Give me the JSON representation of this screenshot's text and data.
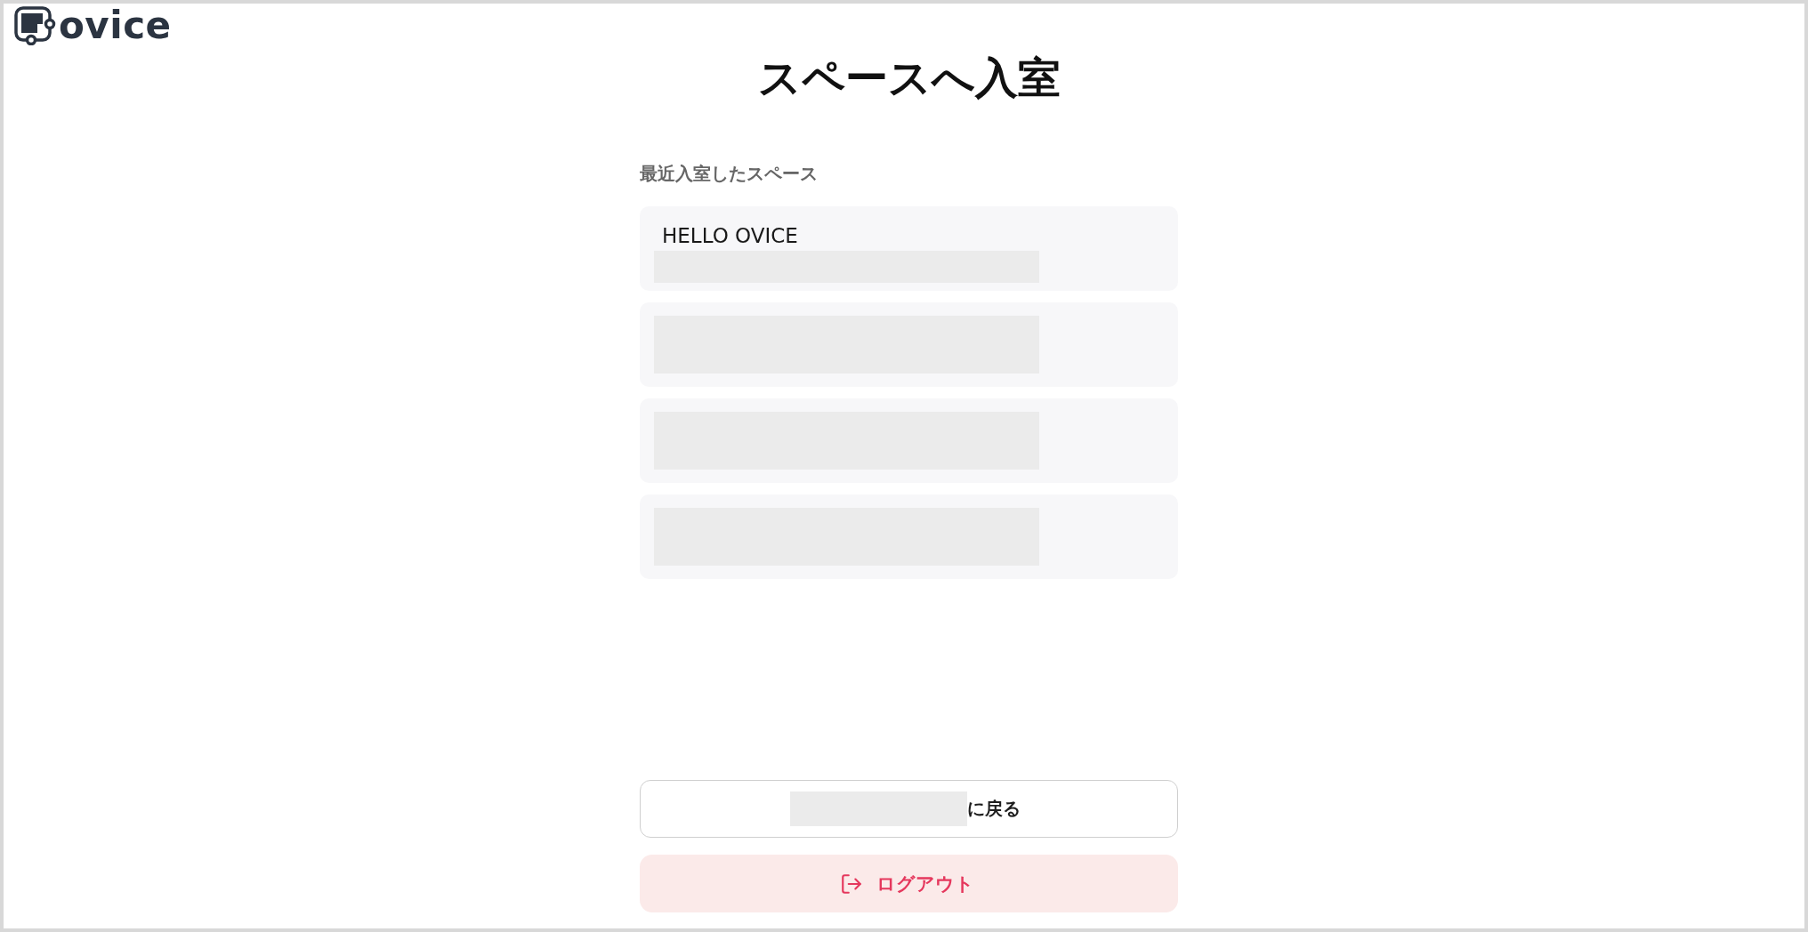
{
  "header": {
    "logo_text": "ovice"
  },
  "title": "スペースへ入室",
  "recent_spaces": {
    "label": "最近入室したスペース",
    "items": [
      {
        "name": "HELLO OVICE",
        "redacted": true
      },
      {
        "redacted": true
      },
      {
        "redacted": true
      },
      {
        "redacted": true
      }
    ]
  },
  "back_button": {
    "label": "に戻る",
    "redacted_prefix": true
  },
  "logout_button": {
    "label": "ログアウト"
  }
}
